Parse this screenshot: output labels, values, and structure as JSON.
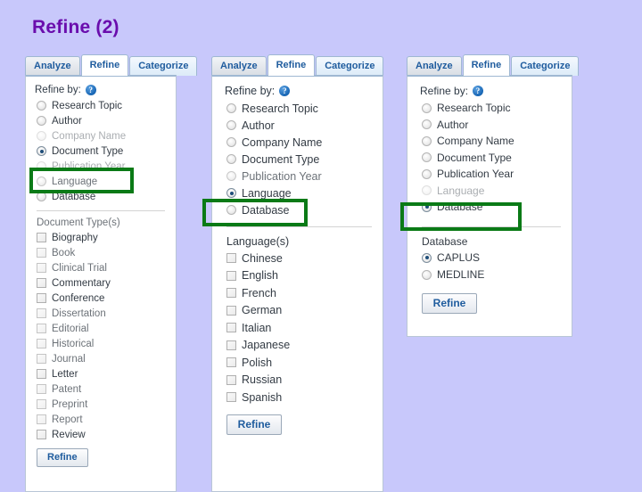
{
  "slide": {
    "title": "Refine (2)",
    "title_color": "#6a0dad",
    "background_color": "#c8c8fb"
  },
  "highlight_color": "#0a7a16",
  "tabs": {
    "analyze": "Analyze",
    "refine": "Refine",
    "categorize": "Categorize"
  },
  "common": {
    "refine_by_label": "Refine by:",
    "help_icon": "question-mark-icon",
    "help_glyph": "?",
    "refine_button": "Refine"
  },
  "refine_by_options": [
    "Research Topic",
    "Author",
    "Company Name",
    "Document Type",
    "Publication Year",
    "Language",
    "Database"
  ],
  "panels": [
    {
      "id": "document-type-panel",
      "selected_refine_by": "Document Type",
      "group_label": "Document Type(s)",
      "items": [
        "Biography",
        "Book",
        "Clinical Trial",
        "Commentary",
        "Conference",
        "Dissertation",
        "Editorial",
        "Historical",
        "Journal",
        "Letter",
        "Patent",
        "Preprint",
        "Report",
        "Review"
      ],
      "item_type": "checkbox",
      "checked_items": []
    },
    {
      "id": "language-panel",
      "selected_refine_by": "Language",
      "group_label": "Language(s)",
      "items": [
        "Chinese",
        "English",
        "French",
        "German",
        "Italian",
        "Japanese",
        "Polish",
        "Russian",
        "Spanish"
      ],
      "item_type": "checkbox",
      "checked_items": []
    },
    {
      "id": "database-panel",
      "selected_refine_by": "Database",
      "group_label": "Database",
      "items": [
        "CAPLUS",
        "MEDLINE"
      ],
      "item_type": "radio",
      "checked_items": [
        "CAPLUS"
      ]
    }
  ]
}
